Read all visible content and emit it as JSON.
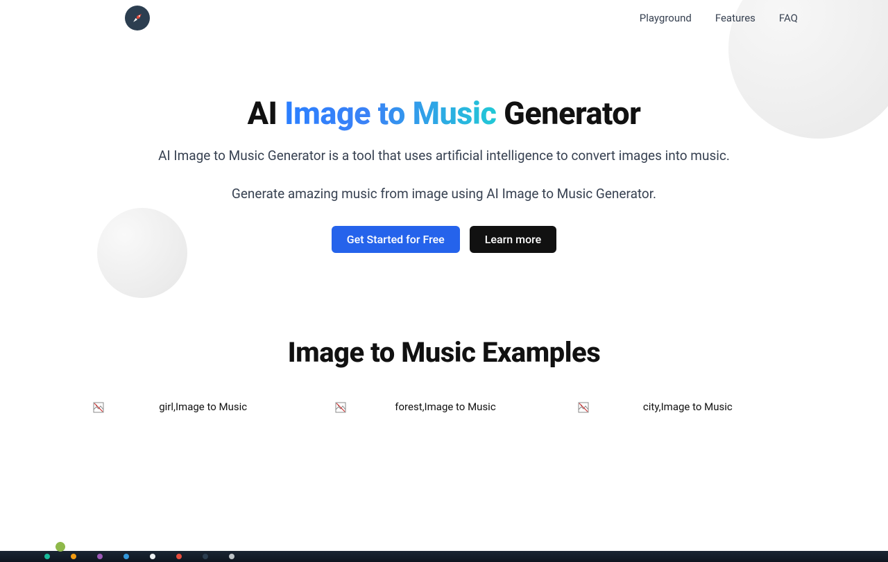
{
  "nav": {
    "items": [
      {
        "label": "Playground"
      },
      {
        "label": "Features"
      },
      {
        "label": "FAQ"
      }
    ]
  },
  "hero": {
    "title_pre": "AI ",
    "title_gradient": "Image to Music",
    "title_post": " Generator",
    "desc1": "AI Image to Music Generator is a tool that uses artificial intelligence to convert images into music.",
    "desc2": "Generate amazing music from image using AI Image to Music Generator.",
    "cta_primary": "Get Started for Free",
    "cta_secondary": "Learn more"
  },
  "examples": {
    "heading": "Image to Music Examples",
    "cards": [
      {
        "alt": "girl,Image to Music"
      },
      {
        "alt": "forest,Image to Music"
      },
      {
        "alt": "city,Image to Music"
      }
    ]
  }
}
